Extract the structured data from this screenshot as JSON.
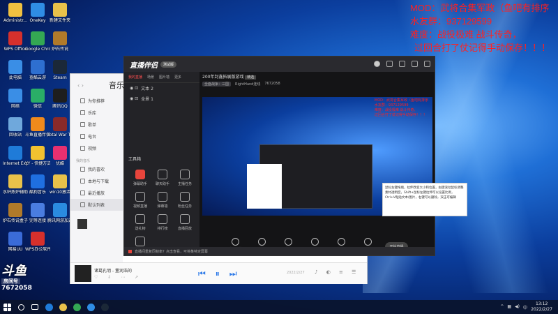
{
  "desktop_icons": [
    {
      "label": "Administr...",
      "color": "#f0c040"
    },
    {
      "label": "OneKey",
      "color": "#2f8de4"
    },
    {
      "label": "新建文件夹",
      "color": "#e8c14a"
    },
    {
      "label": "WPS Office",
      "color": "#d6302c"
    },
    {
      "label": "Google Chrome",
      "color": "#34a853"
    },
    {
      "label": "炉石传说",
      "color": "#b07a2a"
    },
    {
      "label": "此电脑",
      "color": "#3a8ee6"
    },
    {
      "label": "查酷云游",
      "color": "#2e6fd0"
    },
    {
      "label": "Steam",
      "color": "#1b2838"
    },
    {
      "label": "网络",
      "color": "#3a8ee6"
    },
    {
      "label": "微信",
      "color": "#2aae67"
    },
    {
      "label": "腾讯QQ",
      "color": "#1e1e1e"
    },
    {
      "label": "回收站",
      "color": "#6fa8dc"
    },
    {
      "label": "斗鱼直播伴侣",
      "color": "#f08a1c"
    },
    {
      "label": "Total War THREE KI...",
      "color": "#8a2a2a"
    },
    {
      "label": "Internet Explorer",
      "color": "#1f7bd8"
    },
    {
      "label": "YY - 快捷方式",
      "color": "#f2c230"
    },
    {
      "label": "优酷",
      "color": "#e83070"
    },
    {
      "label": "水轩炼炉辅助件",
      "color": "#e8c14a"
    },
    {
      "label": "酷狗音乐",
      "color": "#1f6fe0"
    },
    {
      "label": "win10激活",
      "color": "#e8c14a"
    },
    {
      "label": "炉石传说盒子插件",
      "color": "#b07a2a"
    },
    {
      "label": "完等连接",
      "color": "#4a7de0"
    },
    {
      "label": "腾讯网游加速器",
      "color": "#2a8be0"
    },
    {
      "label": "网易UU",
      "color": "#3a6bd8"
    },
    {
      "label": "WPS办公软件",
      "color": "#d6302c"
    }
  ],
  "overlay": {
    "line1": "MOD：武将合集军政（鱼吧有排序",
    "line2": "水友群：937129599",
    "line3": "难度：战役极难  战斗传奇，",
    "line4": "过回合打了仗记得手动保存！！！"
  },
  "music_app": {
    "title": "音乐",
    "nav": [
      "为你推荐",
      "乐库",
      "歌单",
      "电台",
      "视频"
    ],
    "section": "我的音乐",
    "my": [
      "我的喜欢",
      "本地与下载",
      "最近播放",
      "默认列表"
    ],
    "song": "诸葛孔明 - 董润浩的",
    "time": "2022/2/27"
  },
  "live_app": {
    "logo": "直播伴侣",
    "version": "测试版",
    "tabs": [
      "我的直播",
      "场景",
      "图片墙",
      "更多"
    ],
    "scenes": [
      "文本 2",
      "全景 1"
    ],
    "tools_label": "工具箱",
    "tools": [
      "弹幕助手",
      "聊天助手",
      "主播任务",
      "视频直播",
      "弹幕墙",
      "粉丝任务",
      "送礼物",
      "排行榜",
      "直播回放",
      "更多"
    ],
    "room_title": "200年封鑫拓展版游戏",
    "room_tag": "精选",
    "room_meta": [
      "全面战争：三国",
      "RightHand连线",
      "7672058"
    ],
    "bottom_tools": [
      "直播屏幕",
      "摄像头",
      "手机投屏",
      "多媒体",
      "麦克风",
      "扬声器"
    ],
    "start_btn": "开始直播",
    "status": "直播间重复同帧率？点击查看，可将某特定屏幕"
  },
  "tooltip": {
    "text": "鼠标左键拖拽，拉伸改变大小和位置，右键滚动鼠标调整素材透明度，Shift+鼠标左键拉伸可以设置比例，Ctrl+V粘贴文本/图片，右键可以删除，双击可编辑"
  },
  "douyu": {
    "brand": "斗鱼",
    "sub": "房间号",
    "room": "7672058"
  },
  "taskbar": {
    "apps": [
      {
        "color": "#1f7bd8"
      },
      {
        "color": "#e8c14a"
      },
      {
        "color": "#34a853"
      },
      {
        "color": "#2f8de4"
      },
      {
        "color": "#1b2838"
      }
    ],
    "time": "13:12",
    "date": "2022/2/27",
    "lang": "中"
  }
}
